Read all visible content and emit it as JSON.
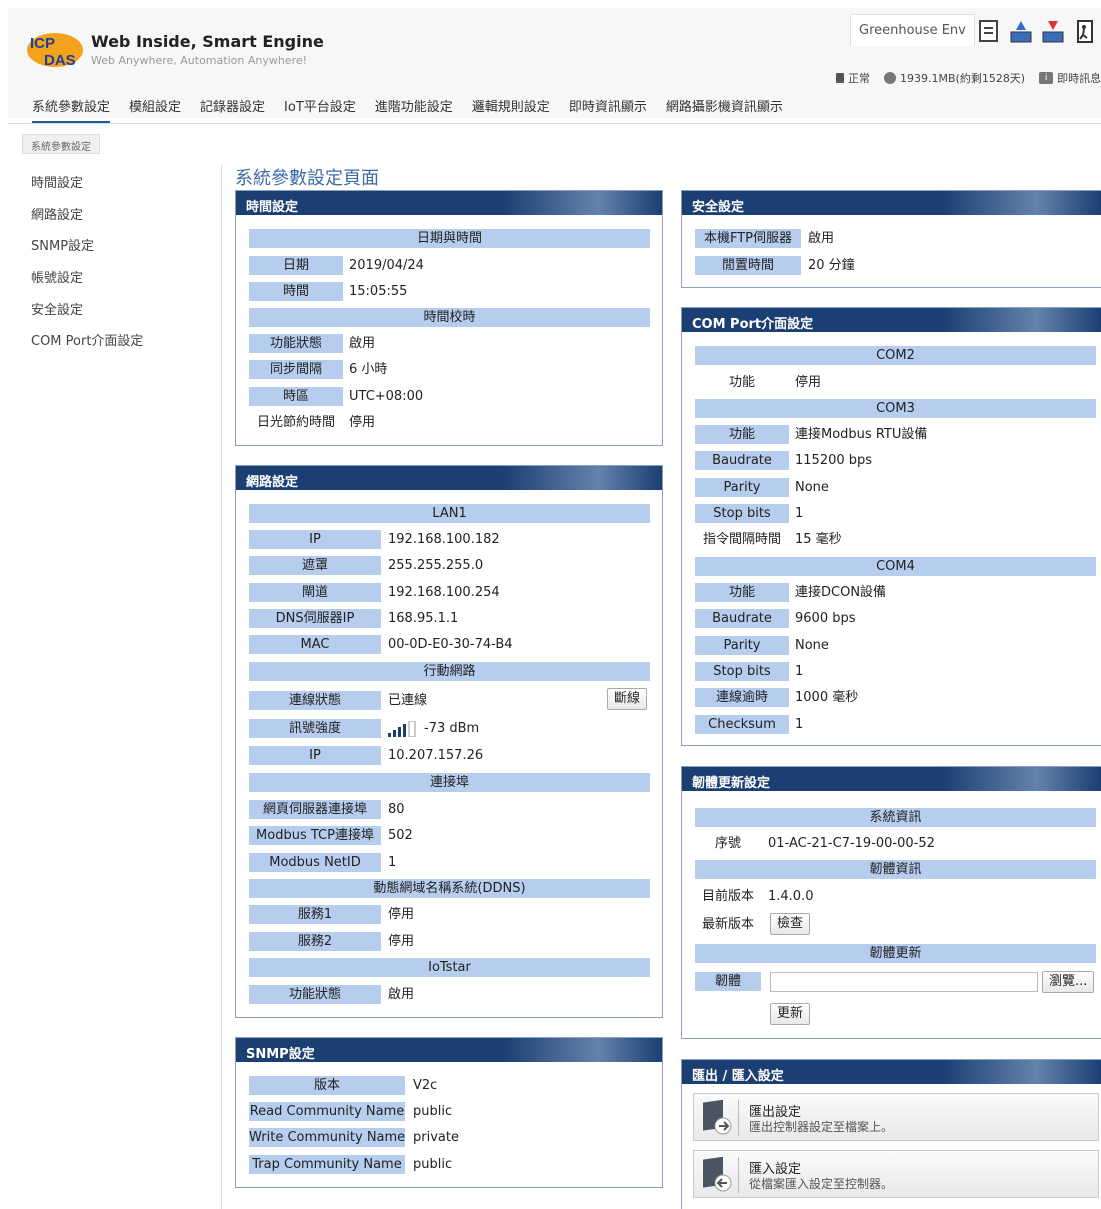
{
  "header": {
    "brand_title": "Web Inside, Smart Engine",
    "brand_sub": "Web Anywhere, Automation Anywhere!",
    "module_name": "Greenhouse Env",
    "status_normal": "正常",
    "storage": "1939.1MB(約剩1528天)",
    "realtime_msg": "即時訊息"
  },
  "nav": {
    "tabs": [
      "系統參數設定",
      "模組設定",
      "記錄器設定",
      "IoT平台設定",
      "進階功能設定",
      "邏輯規則設定",
      "即時資訊顯示",
      "網路攝影機資訊顯示"
    ]
  },
  "breadcrumb": "系統參數設定",
  "sidebar": {
    "items": [
      "時間設定",
      "網路設定",
      "SNMP設定",
      "帳號設定",
      "安全設定",
      "COM Port介面設定"
    ]
  },
  "page_title": "系統參數設定頁面",
  "time": {
    "title": "時間設定",
    "sec1": "日期與時間",
    "date_label": "日期",
    "date": "2019/04/24",
    "time_label": "時間",
    "time": "15:05:55",
    "sec2": "時間校時",
    "func_label": "功能狀態",
    "func": "啟用",
    "sync_label": "同步間隔",
    "sync": "6 小時",
    "tz_label": "時區",
    "tz": "UTC+08:00",
    "dst_label": "日光節約時間",
    "dst": "停用"
  },
  "network": {
    "title": "網路設定",
    "lan": "LAN1",
    "ip_label": "IP",
    "ip": "192.168.100.182",
    "mask_label": "遮罩",
    "mask": "255.255.255.0",
    "gw_label": "閘道",
    "gw": "192.168.100.254",
    "dns_label": "DNS伺服器IP",
    "dns": "168.95.1.1",
    "mac_label": "MAC",
    "mac": "00-0D-E0-30-74-B4",
    "mobile": "行動網路",
    "conn_label": "連線狀態",
    "conn": "已連線",
    "disconnect": "斷線",
    "signal_label": "訊號強度",
    "signal": "-73 dBm",
    "mip_label": "IP",
    "mip": "10.207.157.26",
    "ports": "連接埠",
    "web_label": "網頁伺服器連接埠",
    "web": "80",
    "mtcp_label": "Modbus TCP連接埠",
    "mtcp": "502",
    "netid_label": "Modbus NetID",
    "netid": "1",
    "ddns": "動態網域名稱系統(DDNS)",
    "svc1_label": "服務1",
    "svc1": "停用",
    "svc2_label": "服務2",
    "svc2": "停用",
    "iotstar": "IoTstar",
    "iot_label": "功能狀態",
    "iot": "啟用"
  },
  "snmp": {
    "title": "SNMP設定",
    "ver_label": "版本",
    "ver": "V2c",
    "read_label": "Read Community Name",
    "read": "public",
    "write_label": "Write Community Name",
    "write": "private",
    "trap_label": "Trap Community Name",
    "trap": "public"
  },
  "security": {
    "title": "安全設定",
    "ftp_label": "本機FTP伺服器",
    "ftp": "啟用",
    "idle_label": "閒置時間",
    "idle": "20 分鐘"
  },
  "com": {
    "title": "COM Port介面設定",
    "com2": "COM2",
    "c2_func_label": "功能",
    "c2_func": "停用",
    "com3": "COM3",
    "c3_func_label": "功能",
    "c3_func": "連接Modbus RTU設備",
    "c3_baud_label": "Baudrate",
    "c3_baud": "115200 bps",
    "c3_par_label": "Parity",
    "c3_par": "None",
    "c3_stop_label": "Stop bits",
    "c3_stop": "1",
    "c3_int_label": "指令間隔時間",
    "c3_int": "15 毫秒",
    "com4": "COM4",
    "c4_func_label": "功能",
    "c4_func": "連接DCON設備",
    "c4_baud_label": "Baudrate",
    "c4_baud": "9600 bps",
    "c4_par_label": "Parity",
    "c4_par": "None",
    "c4_stop_label": "Stop bits",
    "c4_stop": "1",
    "c4_to_label": "連線逾時",
    "c4_to": "1000 毫秒",
    "c4_chk_label": "Checksum",
    "c4_chk": "1"
  },
  "firmware": {
    "title": "韌體更新設定",
    "sysinfo": "系統資訊",
    "serial_label": "序號",
    "serial": "01-AC-21-C7-19-00-00-52",
    "fwinfo": "韌體資訊",
    "cur_label": "目前版本",
    "cur": "1.4.0.0",
    "latest_label": "最新版本",
    "check": "檢查",
    "fwupdate": "韌體更新",
    "file_label": "韌體",
    "browse": "瀏覽...",
    "update": "更新"
  },
  "export": {
    "title": "匯出 / 匯入設定",
    "exp_title": "匯出設定",
    "exp_desc": "匯出控制器設定至檔案上。",
    "imp_title": "匯入設定",
    "imp_desc": "從檔案匯入設定至控制器。"
  },
  "colors": {
    "panel_header": "#1b3f73",
    "label_bg": "#b6cdee",
    "accent": "#1e5aa0",
    "title": "#3e6aa7"
  }
}
